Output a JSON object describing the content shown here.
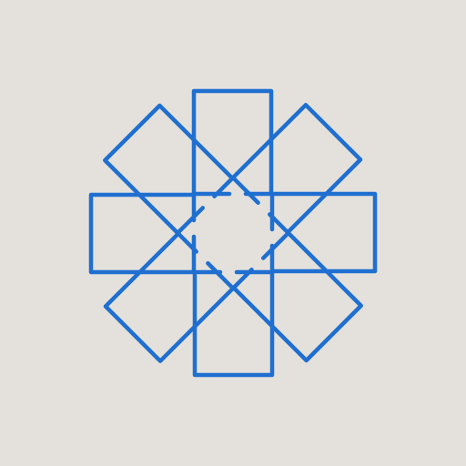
{
  "background_color": "#e4e1dc",
  "icon": "pinwheel-logo-icon",
  "logo": {
    "stroke_color": "#1f6fd0",
    "blade_count": 8,
    "style": "outline, interlocking rectangles"
  }
}
